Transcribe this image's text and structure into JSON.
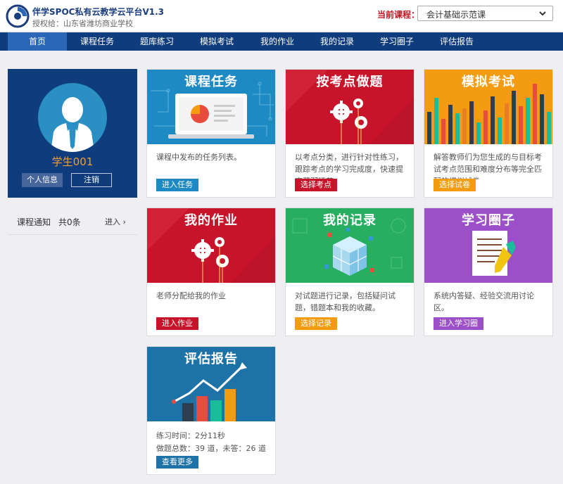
{
  "header": {
    "app_title": "伴学SPOC私有云教学云平台V1.3",
    "licensed_to": "授权给：山东省潍坊商业学校",
    "course_label": "当前课程：",
    "course_value": "会计基础示范课"
  },
  "nav": [
    "首页",
    "课程任务",
    "题库练习",
    "模拟考试",
    "我的作业",
    "我的记录",
    "学习圈子",
    "评估报告"
  ],
  "profile": {
    "name": "学生001",
    "info_button": "个人信息",
    "logout_button": "注销"
  },
  "notice": {
    "label": "课程通知",
    "count": "共0条",
    "enter": "进入 ›"
  },
  "cards": [
    {
      "title": "课程任务",
      "desc": "课程中发布的任务列表。",
      "button": "进入任务",
      "color": "#1d8ac3"
    },
    {
      "title": "按考点做题",
      "desc": "以考点分类，进行针对性练习，跟踪考点的学习完成度，快速提高薄弱环节",
      "button": "选择考点",
      "color": "#c8142a"
    },
    {
      "title": "模拟考试",
      "desc": "解答教师们为您生成的与目标考试考点范围和难度分布等完全匹配的模拟试卷",
      "button": "选择试卷",
      "color": "#f39c12"
    },
    {
      "title": "我的作业",
      "desc": "老师分配给我的作业",
      "button": "进入作业",
      "color": "#c8142a"
    },
    {
      "title": "我的记录",
      "desc": "对试题进行记录，包括疑问试题，错题本和我的收藏。",
      "button": "选择记录",
      "color": "#f39c12"
    },
    {
      "title": "学习圈子",
      "desc": "系统内答疑、经验交流用讨论区。",
      "button": "进入学习圈",
      "color": "#9b4fc8"
    },
    {
      "title": "评估报告",
      "button": "查看更多",
      "color": "#1d72a8"
    }
  ],
  "report": {
    "practice_time": "练习时间：2分11秒",
    "totals": "做题总数：39 道，未答：26 道"
  }
}
